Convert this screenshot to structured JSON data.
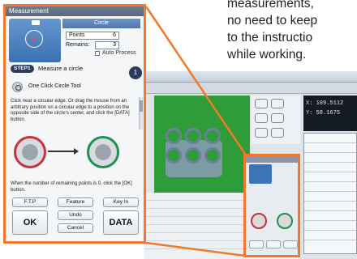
{
  "caption": {
    "lines": [
      "measurements,",
      "no need to keep",
      "to the instructio",
      "while working."
    ]
  },
  "dialog": {
    "title": "Measurement",
    "header": "Circle",
    "fields": {
      "points_label": "Points",
      "points_value": "6"
    },
    "remains_label": "Remains:",
    "remains_value": "3",
    "auto_process": "Auto Process",
    "step_badge": "STEP1",
    "step_title": "Measure a circle",
    "step_number": "1",
    "tool_name": "One Click Circle Tool",
    "instruction": "Click near a circular edge. Or drag the mouse from an arbitrary position on a circular edge to a position on the opposite side of the circle's center, and click the [DATA] button.",
    "note": "When the number of remaining points is 0, click the [OK] button.",
    "buttons": {
      "ftp": "F.T.P",
      "feature": "Feature",
      "key_in": "Key In",
      "undo": "Undo",
      "cancel": "Cancel",
      "ok": "OK",
      "data": "DATA"
    }
  },
  "background_app": {
    "readout_x_label": "X:",
    "readout_x_value": "109.5112",
    "readout_y_label": "Y:",
    "readout_y_value": "58.1675"
  },
  "colors": {
    "frame": "#f07a2a",
    "panel": "#3a6fb2",
    "red_ring": "#c8323b",
    "green_ring": "#1f9153",
    "work_area": "#2f9c3a"
  }
}
